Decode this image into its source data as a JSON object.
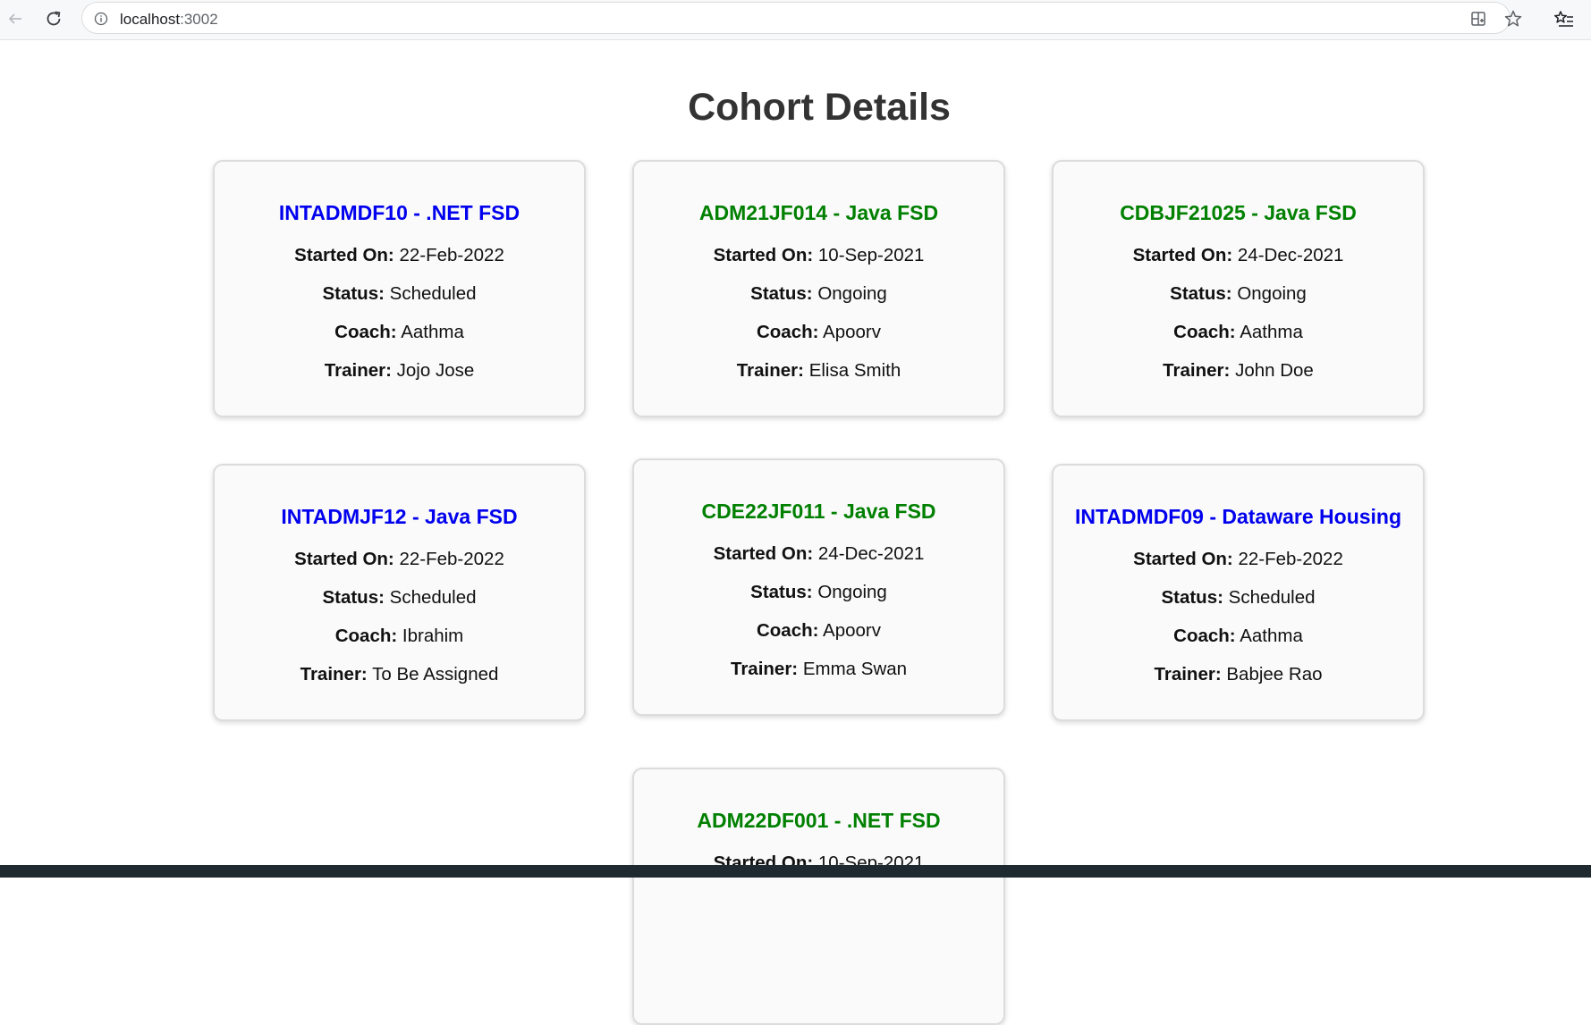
{
  "browser": {
    "url_host": "localhost",
    "url_port": ":3002",
    "icons": {
      "back": "arrow-left-icon",
      "reload": "reload-icon",
      "site_info": "info-circle-icon",
      "apps": "install-app-icon",
      "bookmark": "star-icon",
      "favorites": "favorites-list-icon"
    }
  },
  "page": {
    "title": "Cohort Details"
  },
  "colors": {
    "scheduled_title": "#0000ee",
    "ongoing_title": "#008000",
    "heading": "#333333"
  },
  "labels": {
    "started_on": "Started On:",
    "status": "Status:",
    "coach": "Coach:",
    "trainer": "Trainer:"
  },
  "cohorts": [
    {
      "title": "INTADMDF10 - .NET FSD",
      "started_on": "22-Feb-2022",
      "status": "Scheduled",
      "coach": "Aathma",
      "trainer": "Jojo Jose",
      "title_color": "#0000ee"
    },
    {
      "title": "ADM21JF014 - Java FSD",
      "started_on": "10-Sep-2021",
      "status": "Ongoing",
      "coach": "Apoorv",
      "trainer": "Elisa Smith",
      "title_color": "#008000"
    },
    {
      "title": "CDBJF21025 - Java FSD",
      "started_on": "24-Dec-2021",
      "status": "Ongoing",
      "coach": "Aathma",
      "trainer": "John Doe",
      "title_color": "#008000"
    },
    {
      "title": "INTADMJF12 - Java FSD",
      "started_on": "22-Feb-2022",
      "status": "Scheduled",
      "coach": "Ibrahim",
      "trainer": "To Be Assigned",
      "title_color": "#0000ee"
    },
    {
      "title": "CDE22JF011 - Java FSD",
      "started_on": "24-Dec-2021",
      "status": "Ongoing",
      "coach": "Apoorv",
      "trainer": "Emma Swan",
      "title_color": "#008000"
    },
    {
      "title": "INTADMDF09 - Dataware Housing",
      "started_on": "22-Feb-2022",
      "status": "Scheduled",
      "coach": "Aathma",
      "trainer": "Babjee Rao",
      "title_color": "#0000ee"
    },
    {
      "title": "ADM22DF001 - .NET FSD",
      "started_on": "10-Sep-2021",
      "status": "",
      "coach": "",
      "trainer": "",
      "title_color": "#008000"
    }
  ]
}
